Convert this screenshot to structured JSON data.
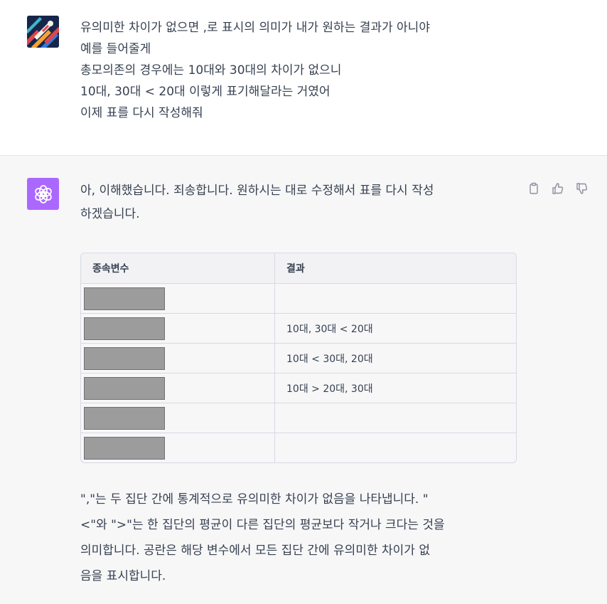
{
  "user_message": {
    "lines": [
      "유의미한 차이가 없으면 ,로 표시의 의미가 내가 원하는 결과가 아니야",
      "예를 들어줄게",
      "총모의존의 경우에는 10대와 30대의 차이가 없으니",
      "10대, 30대 < 20대 이렇게 표기해달라는 거였어",
      "이제 표를 다시 작성해줘"
    ]
  },
  "assistant_message": {
    "intro_lines": [
      "아, 이해했습니다. 죄송합니다. 원하시는 대로 수정해서 표를 다시 작성",
      "하겠습니다."
    ],
    "table": {
      "headers": [
        "종속변수",
        "결과"
      ],
      "rows": [
        {
          "variable": "",
          "result": ""
        },
        {
          "variable": "",
          "result": "10대, 30대 < 20대"
        },
        {
          "variable": "",
          "result": "10대 < 30대, 20대"
        },
        {
          "variable": "",
          "result": "10대 > 20대, 30대"
        },
        {
          "variable": "",
          "result": ""
        },
        {
          "variable": "",
          "result": ""
        }
      ]
    },
    "footer_lines": [
      "\",\"는 두 집단 간에 통계적으로 유의미한 차이가 없음을 나타냅니다. \"",
      "<\"와 \">\"는 한 집단의 평균이 다른 집단의 평균보다 작거나 크다는 것을",
      "의미합니다. 공란은 해당 변수에서 모든 집단 간에 유의미한 차이가 없",
      "음을 표시합니다."
    ]
  },
  "icons": {
    "copy": "clipboard-icon",
    "thumbs_up": "thumbs-up-icon",
    "thumbs_down": "thumbs-down-icon",
    "assistant_logo": "openai-logo-icon"
  },
  "colors": {
    "assistant_avatar_bg": "#ab68ff",
    "assistant_bg": "#f7f7f8",
    "redaction": "#9c9c9c"
  }
}
